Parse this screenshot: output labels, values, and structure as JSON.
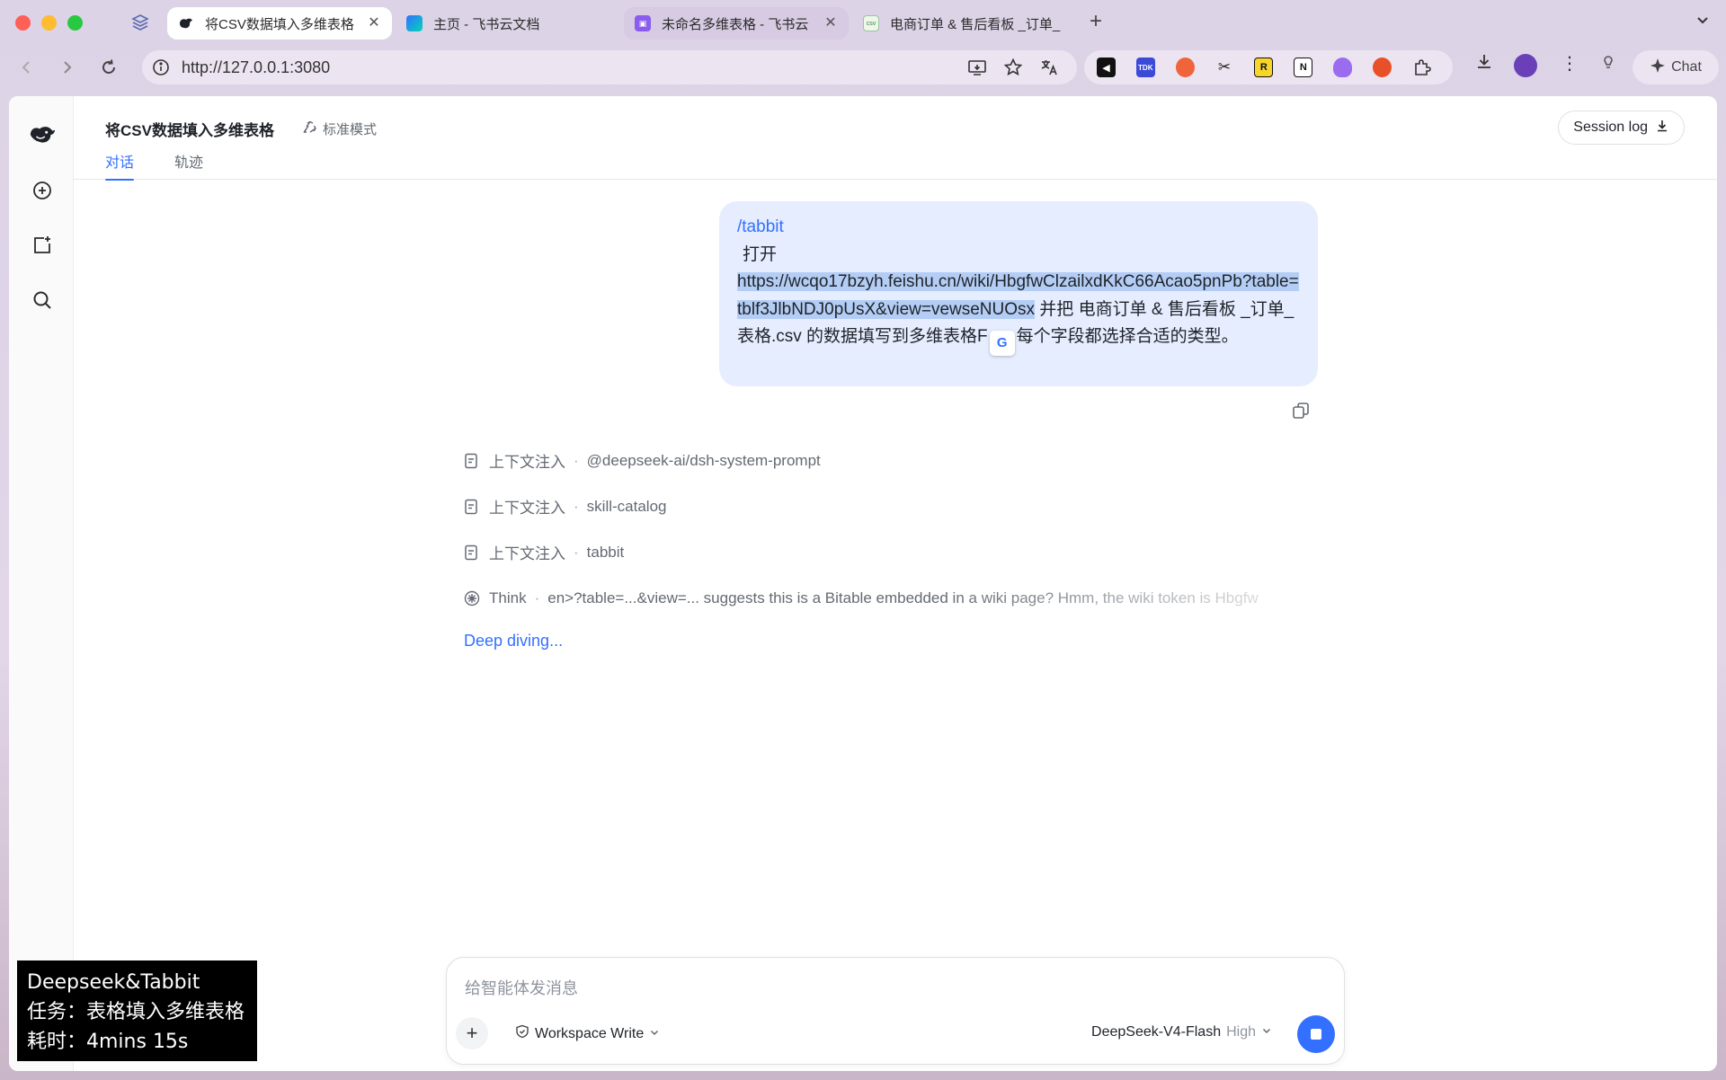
{
  "browser": {
    "tabs": [
      {
        "title": "将CSV数据填入多维表格",
        "state": "active"
      },
      {
        "title": "主页 - 飞书云文档",
        "state": "normal"
      },
      {
        "title": "未命名多维表格 - 飞书云",
        "state": "hover"
      },
      {
        "title": "电商订单 & 售后看板 _订单_",
        "state": "normal"
      }
    ],
    "url": "http://127.0.0.1:3080",
    "chat_label": "Chat",
    "ext_labels": [
      "TDK",
      "R",
      "N"
    ]
  },
  "app": {
    "title": "将CSV数据填入多维表格",
    "mode": "标准模式",
    "tabs": [
      "对话",
      "轨迹"
    ],
    "session_log": "Session log"
  },
  "message": {
    "command": "/tabbit",
    "line1": "打开",
    "link": "https://wcqo17bzyh.feishu.cn/wiki/HbgfwClzailxdKkC66Acao5pnPb?table=tblf3JlbNDJ0pUsX&view=vewseNUOsx",
    "rest_a": " 并把 电商订单 & 售后看板 _订单_表格.csv 的数据填写到多维表格F",
    "rest_b": "每个字段都选择合适的类型。"
  },
  "steps": [
    {
      "kind": "上下文注入",
      "value": "@deepseek-ai/dsh-system-prompt"
    },
    {
      "kind": "上下文注入",
      "value": "skill-catalog"
    },
    {
      "kind": "上下文注入",
      "value": "tabbit"
    },
    {
      "kind": "Think",
      "value": "en>?table=...&view=... suggests this is a Bitable embedded in a wiki page? Hmm, the wiki token is Hbgfw"
    }
  ],
  "status": "Deep diving...",
  "composer": {
    "placeholder": "给智能体发消息",
    "workspace": "Workspace Write",
    "model": "DeepSeek-V4-Flash",
    "level": "High"
  },
  "overlay": {
    "line1": "Deepseek&Tabbit",
    "line2": "任务：表格填入多维表格",
    "line3": "耗时：4mins 15s"
  },
  "colors": {
    "accent": "#3370ff",
    "bubble": "#e5edff",
    "selection": "#b4cdf5"
  }
}
